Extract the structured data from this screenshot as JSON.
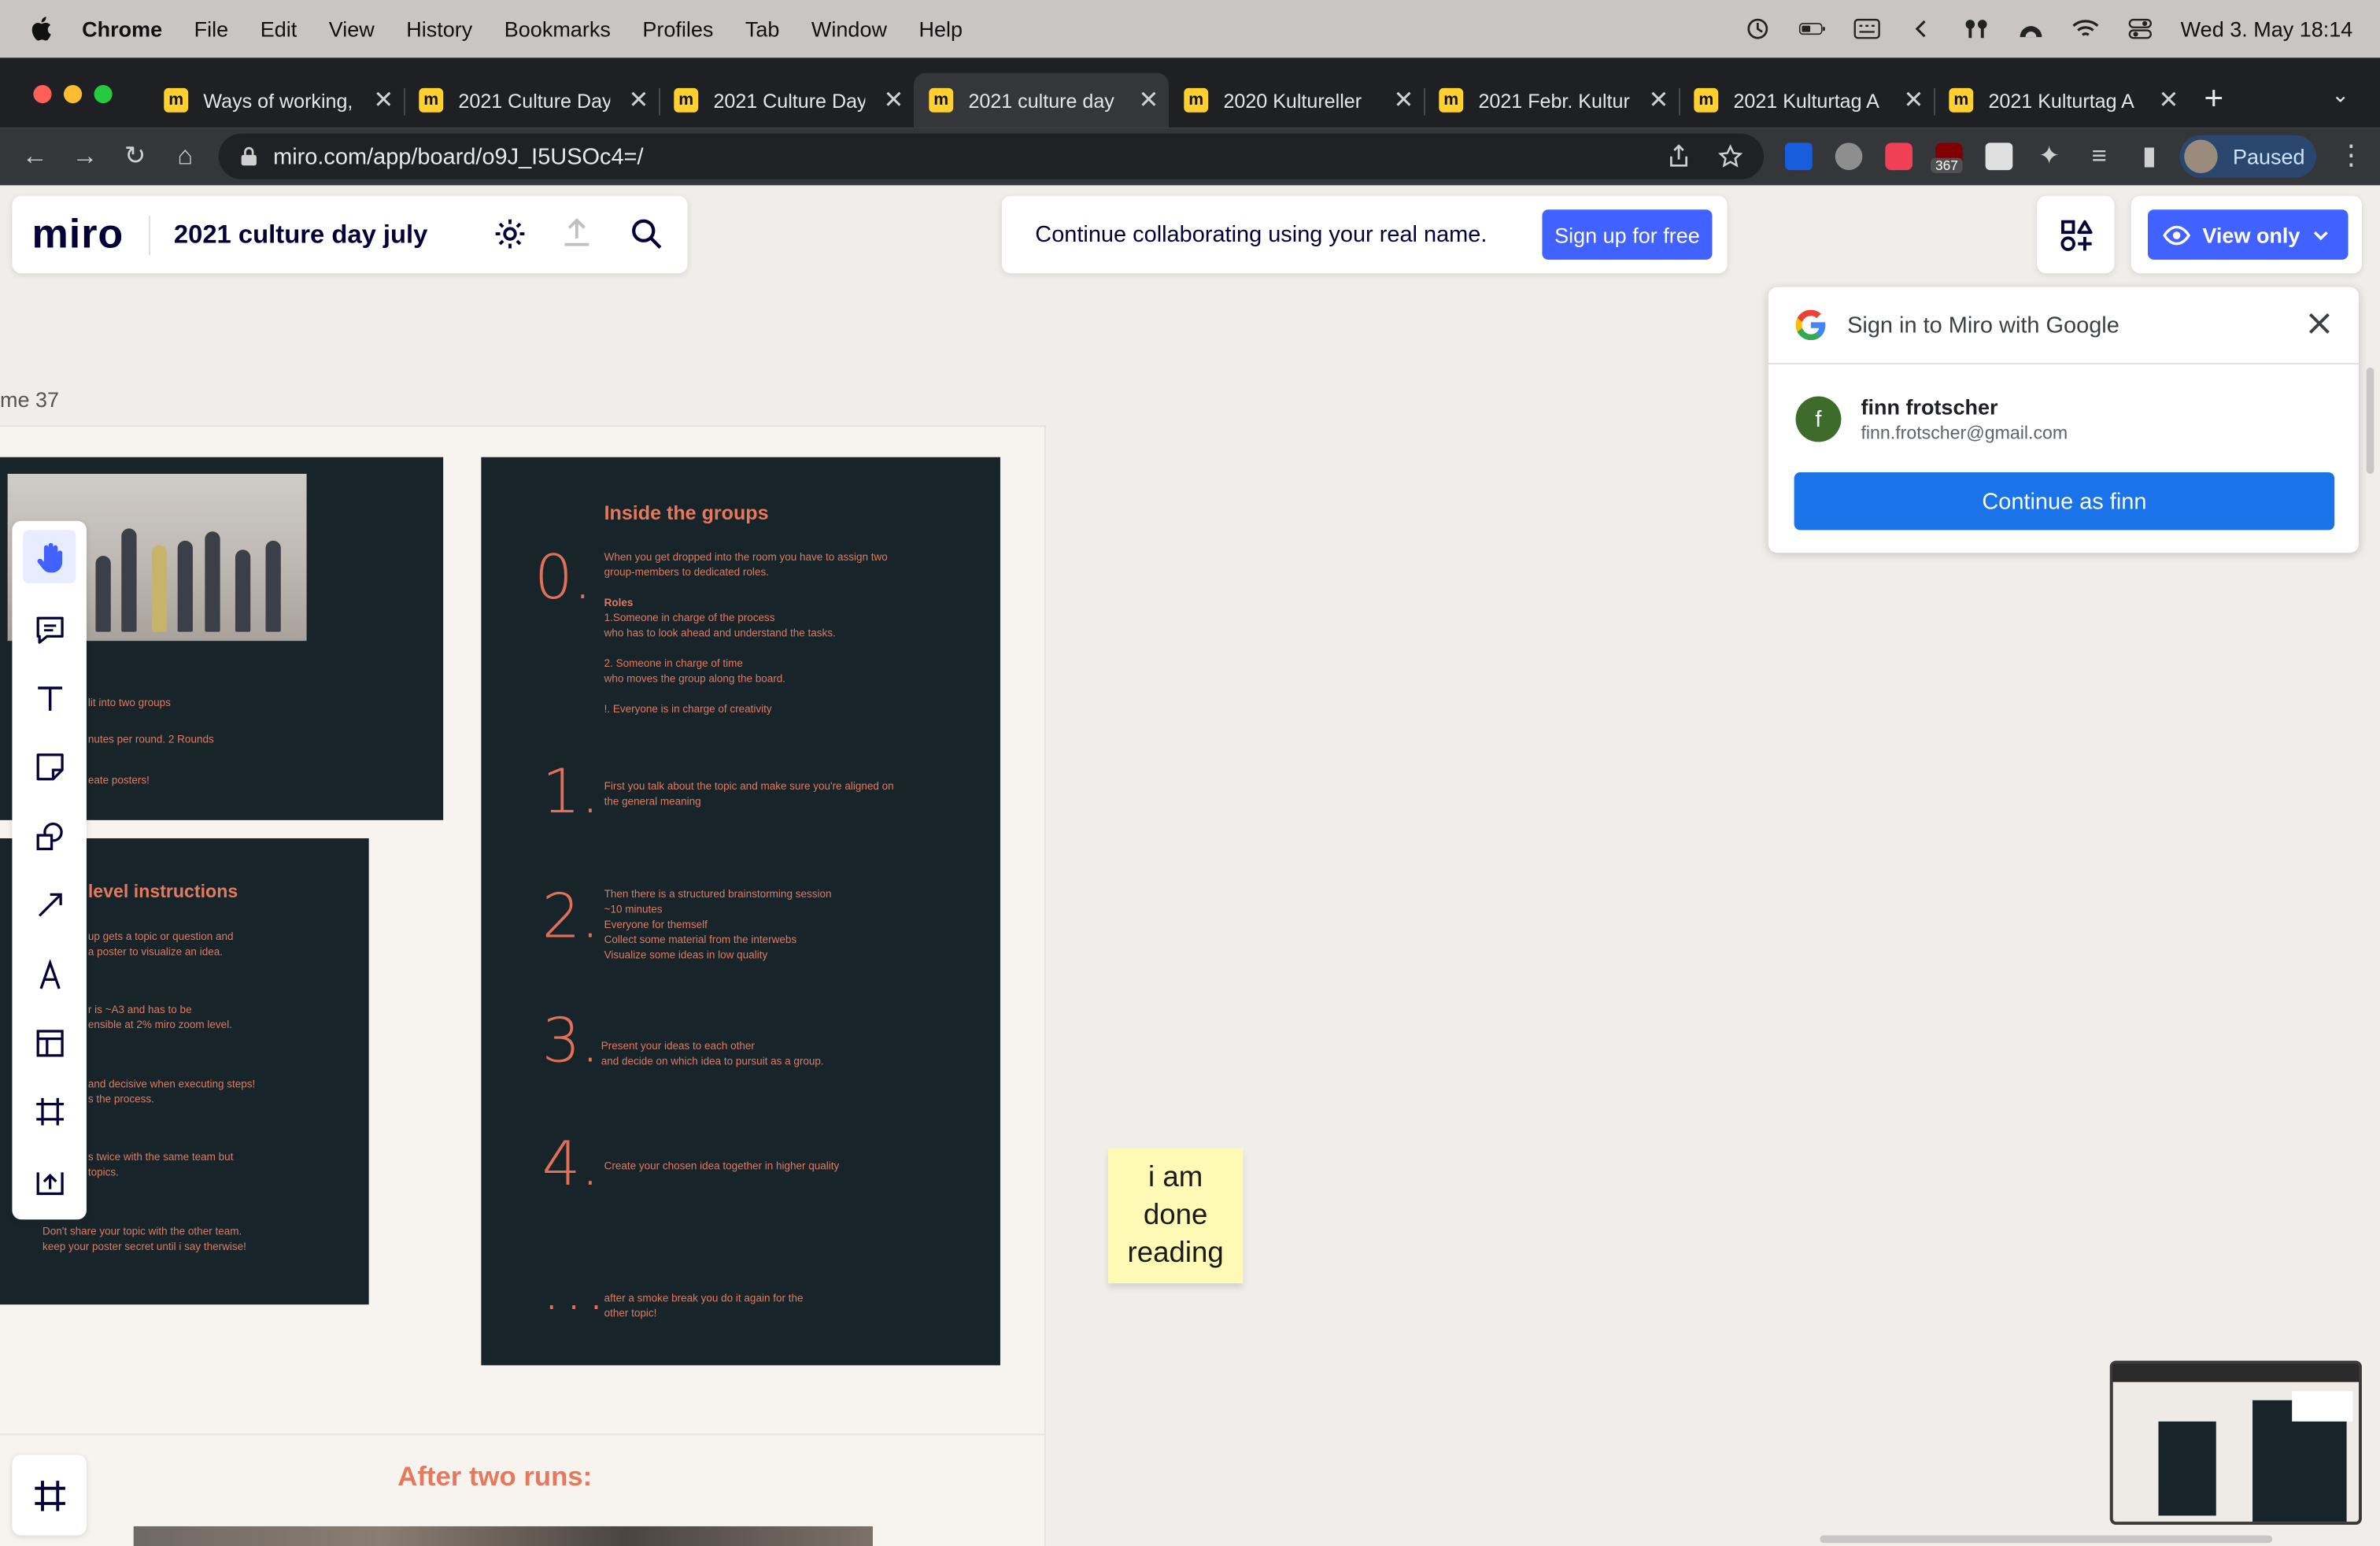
{
  "menubar": {
    "app": "Chrome",
    "items": [
      "File",
      "Edit",
      "View",
      "History",
      "Bookmarks",
      "Profiles",
      "Tab",
      "Window",
      "Help"
    ],
    "clock": "Wed 3. May  18:14"
  },
  "tabs": [
    {
      "title": "Ways of working,",
      "active": false
    },
    {
      "title": "2021 Culture Day",
      "active": false
    },
    {
      "title": "2021 Culture Day",
      "active": false
    },
    {
      "title": "2021 culture day",
      "active": true
    },
    {
      "title": "2020 Kultureller",
      "active": false
    },
    {
      "title": "2021 Febr. Kultur",
      "active": false
    },
    {
      "title": "2021 Kulturtag A",
      "active": false
    },
    {
      "title": "2021 Kulturtag A",
      "active": false
    }
  ],
  "toolbar": {
    "url": "miro.com/app/board/o9J_I5USOc4=/",
    "ext_badge": "367",
    "profile_label": "Paused"
  },
  "miro": {
    "logo": "miro",
    "board_title": "2021 culture day july",
    "banner_text": "Continue collaborating using your real name.",
    "signup_label": "Sign up for free",
    "view_only_label": "View only"
  },
  "google_popup": {
    "title": "Sign in to Miro with Google",
    "initial": "f",
    "name": "finn frotscher",
    "email": "finn.frotscher@gmail.com",
    "continue_label": "Continue as finn"
  },
  "canvas": {
    "frame_label": "me 37",
    "left_slide_lines": [
      "lit into two groups",
      "nutes per round. 2 Rounds",
      "eate posters!"
    ],
    "level_title": "level instructions",
    "level_lines": [
      "up gets a topic or question and",
      "a poster to visualize an idea.",
      "r is ~A3 and has to be",
      "ensible at 2% miro zoom level.",
      "and decisive when executing steps!",
      "s the process.",
      "s twice with the same team but",
      "topics.",
      "Don't share your topic with the other team.",
      "keep your poster secret until i say therwise!"
    ],
    "groups_title": "Inside the groups",
    "steps": [
      {
        "num": "0.",
        "lines": [
          "When you get dropped into the room you have to assign two",
          "group-members to dedicated roles.",
          "",
          "Roles",
          "1.Someone in charge of the process",
          "who has to look ahead and understand the tasks.",
          "",
          "2. Someone in charge of time",
          "who moves the group along the board.",
          "",
          "!. Everyone is in charge of creativity"
        ]
      },
      {
        "num": "1.",
        "lines": [
          "First you talk about the topic and make sure you're aligned on",
          "the general meaning"
        ]
      },
      {
        "num": "2.",
        "lines": [
          "Then there is a structured brainstorming session",
          "~10 minutes",
          "Everyone for themself",
          "Collect some material from the interwebs",
          "Visualize some ideas in low quality"
        ]
      },
      {
        "num": "3.",
        "lines": [
          "Present your ideas to each other",
          "and decide on which idea to pursuit as a group."
        ]
      },
      {
        "num": "4.",
        "lines": [
          "Create your chosen idea together in higher quality"
        ]
      },
      {
        "num": "...",
        "lines": [
          "after a smoke break you do it again for the",
          "other topic!"
        ]
      }
    ],
    "after_runs": "After two runs:",
    "sticky": [
      "i am",
      "done",
      "reading"
    ]
  },
  "colors": {
    "miro_blue": "#4262ff",
    "google_blue": "#1a73e8",
    "slide_bg": "#17252b",
    "slide_accent": "#e36f55",
    "sticky": "#fef9b4"
  }
}
